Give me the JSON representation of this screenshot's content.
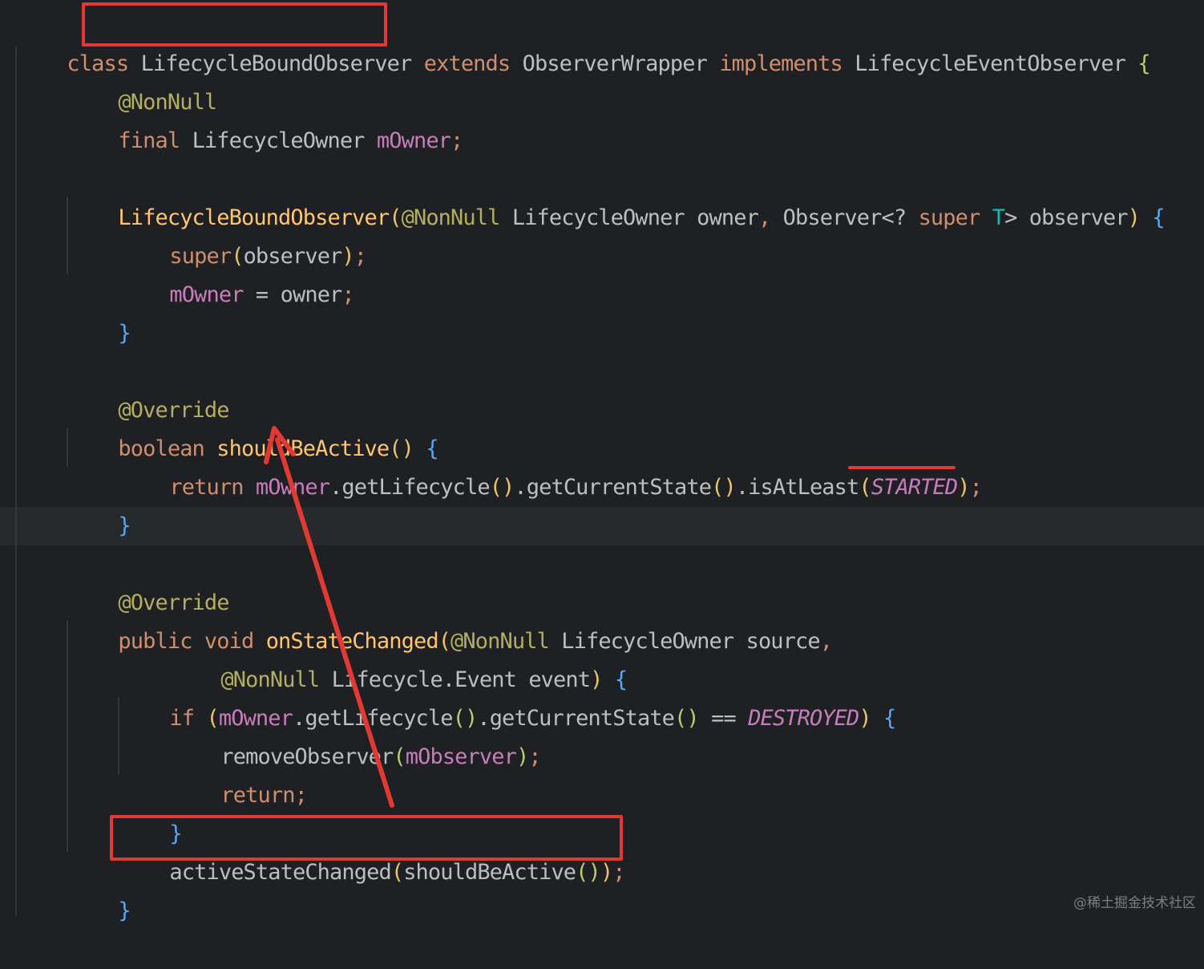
{
  "code": {
    "line1": {
      "kw_class": "class",
      "class_name": "LifecycleBoundObserver",
      "kw_extends": "extends",
      "super_type": "ObserverWrapper",
      "kw_implements": "implements",
      "iface": "LifecycleEventObserver",
      "brace": "{"
    },
    "line2": {
      "ann": "@NonNull"
    },
    "line3": {
      "kw": "final",
      "type": "LifecycleOwner",
      "field": "mOwner",
      "semi": ";"
    },
    "line5": {
      "ctor": "LifecycleBoundObserver",
      "p_open": "(",
      "ann": "@NonNull",
      "type1": "LifecycleOwner",
      "arg1": "owner",
      "comma": ",",
      "type2": "Observer<?",
      "kw_super": "super",
      "generic": "T",
      "gt": ">",
      "arg2": "observer",
      "p_close": ")",
      "brace": "{"
    },
    "line6": {
      "kw": "super",
      "p_open": "(",
      "arg": "observer",
      "p_close": ")",
      "semi": ";"
    },
    "line7": {
      "field": "mOwner",
      "op": "=",
      "val": "owner",
      "semi": ";"
    },
    "line8": {
      "brace": "}"
    },
    "line10": {
      "ann": "@Override"
    },
    "line11": {
      "kw": "boolean",
      "fn": "shouldBeActive",
      "parens": "()",
      "brace": "{"
    },
    "line12": {
      "kw": "return",
      "field": "mOwner",
      "call1": ".getLifecycle",
      "parens1": "()",
      "call2": ".getCurrentState",
      "parens2": "()",
      "call3": ".isAtLeast",
      "p_open": "(",
      "const": "STARTED",
      "p_close": ")",
      "semi": ";"
    },
    "line13": {
      "brace": "}"
    },
    "line15": {
      "ann": "@Override"
    },
    "line16": {
      "kw_public": "public",
      "kw_void": "void",
      "fn": "onStateChanged",
      "p_open": "(",
      "ann": "@NonNull",
      "type": "LifecycleOwner",
      "arg": "source",
      "comma": ","
    },
    "line17": {
      "ann": "@NonNull",
      "type": "Lifecycle.Event",
      "arg": "event",
      "p_close": ")",
      "brace": "{"
    },
    "line18": {
      "kw": "if",
      "p_open": "(",
      "field": "mOwner",
      "call1": ".getLifecycle",
      "parens1": "()",
      "call2": ".getCurrentState",
      "parens2": "()",
      "op": "==",
      "const": "DESTROYED",
      "p_close": ")",
      "brace": "{"
    },
    "line19": {
      "fn": "removeObserver",
      "p_open": "(",
      "field": "mObserver",
      "p_close": ")",
      "semi": ";"
    },
    "line20": {
      "kw": "return",
      "semi": ";"
    },
    "line21": {
      "brace": "}"
    },
    "line22": {
      "fn": "activeStateChanged",
      "p_open": "(",
      "call": "shouldBeActive",
      "parens": "()",
      "p_close": ")",
      "semi": ";"
    },
    "line23": {
      "brace": "}"
    }
  },
  "annotation_color": "#e23a33",
  "watermark": "@稀土掘金技术社区"
}
